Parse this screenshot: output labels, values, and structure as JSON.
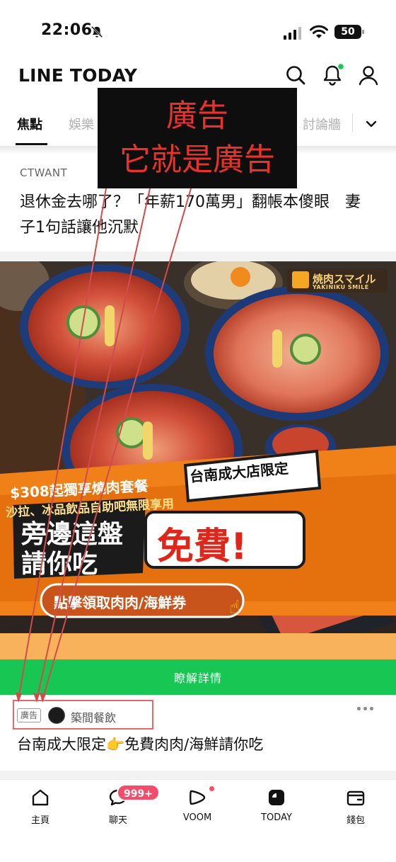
{
  "status_bar": {
    "time": "22:06",
    "battery": "50"
  },
  "header": {
    "title": "LINE TODAY"
  },
  "tabs": [
    {
      "label": "焦點",
      "active": true
    },
    {
      "label": "娛樂",
      "active": false
    },
    {
      "label": "討論牆",
      "active": false
    }
  ],
  "annotation": {
    "line1": "廣告",
    "line2": "它就是廣告"
  },
  "article": {
    "source": "CTWANT",
    "headline": "退休金去哪了？「年薪170萬男」翻帳本傻眼　妻子1句話讓他沉默"
  },
  "ad": {
    "brand_jp": "焼肉スマイル",
    "brand_en": "YAKINIKU SMILE",
    "store_tag": "台南成大店限定",
    "price_line": "$308起獨享燒肉套餐",
    "sub_line": "沙拉、冰品飲品自助吧無限享用",
    "big_left_1": "旁邊這盤",
    "big_left_2": "請你吃",
    "big_right": "免費!",
    "coupon": "點擊領取肉肉/海鮮券",
    "cta": "瞭解詳情",
    "tag": "廣告",
    "advertiser": "築間餐飲",
    "title": "台南成大限定👉免費肉肉/海鮮請你吃"
  },
  "bottom_nav": [
    {
      "label": "主頁",
      "icon": "home-icon"
    },
    {
      "label": "聊天",
      "icon": "chat-icon",
      "badge": "999+"
    },
    {
      "label": "VOOM",
      "icon": "voom-icon"
    },
    {
      "label": "TODAY",
      "icon": "today-icon"
    },
    {
      "label": "錢包",
      "icon": "wallet-icon"
    }
  ],
  "colors": {
    "green": "#17c653",
    "annotation_red": "#e8322a",
    "badge": "#f44c6a"
  }
}
